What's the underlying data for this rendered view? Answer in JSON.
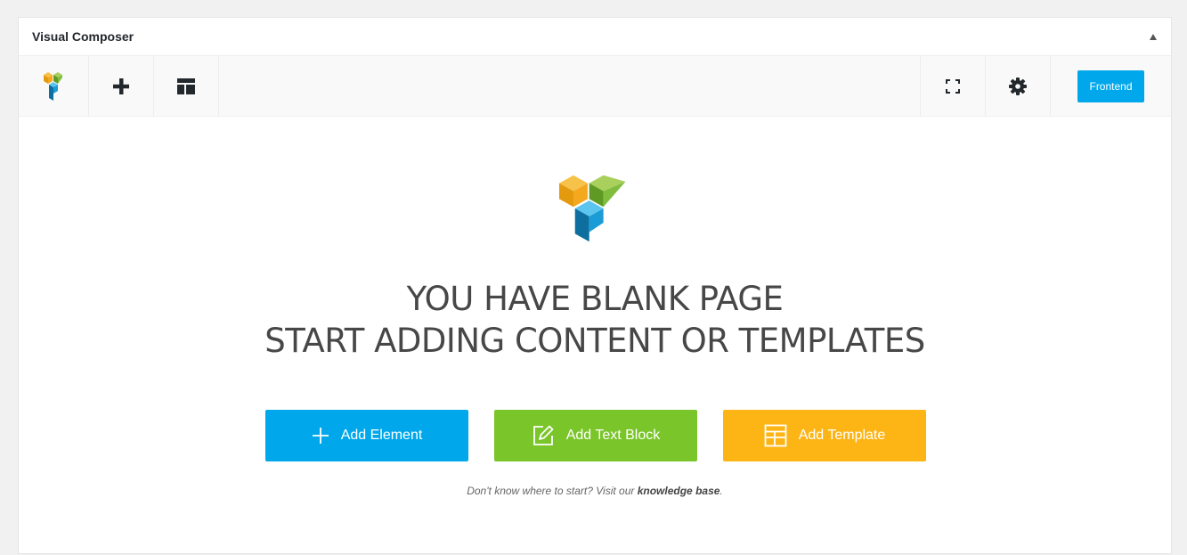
{
  "panel": {
    "title": "Visual Composer"
  },
  "toolbar": {
    "icons": [
      "vc-logo-icon",
      "plus-icon",
      "template-icon",
      "fullscreen-icon",
      "gear-icon"
    ],
    "frontend_label": "Frontend"
  },
  "empty_state": {
    "line1": "YOU HAVE BLANK PAGE",
    "line2": "START ADDING CONTENT OR TEMPLATES",
    "actions": [
      {
        "label": "Add Element",
        "icon": "plus-icon",
        "color": "#00a8eb"
      },
      {
        "label": "Add Text Block",
        "icon": "edit-icon",
        "color": "#7ac52a"
      },
      {
        "label": "Add Template",
        "icon": "template-icon",
        "color": "#fdb515"
      }
    ],
    "hint_prefix": "Don't know where to start? Visit our ",
    "hint_link": "knowledge base",
    "hint_suffix": "."
  },
  "colors": {
    "accent": "#00a8eb",
    "green": "#7ac52a",
    "orange": "#fdb515"
  }
}
